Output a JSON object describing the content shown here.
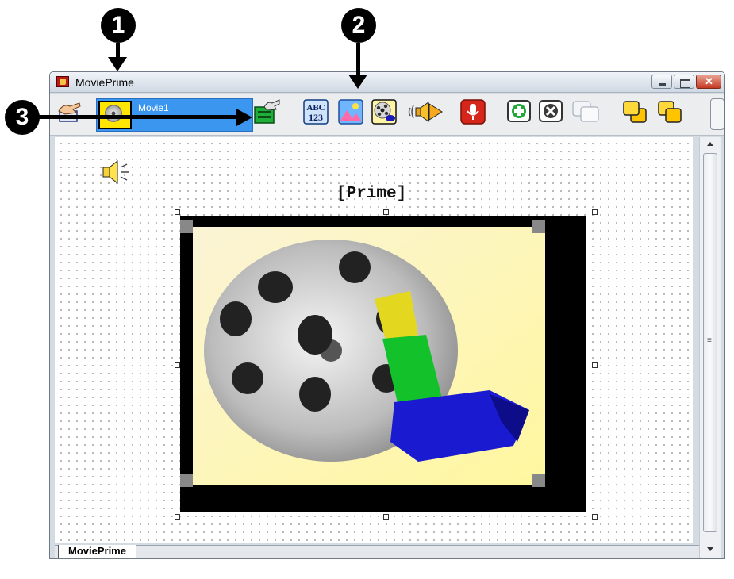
{
  "callouts": [
    "1",
    "2",
    "3"
  ],
  "window": {
    "title": "MoviePrime"
  },
  "toolbar": {
    "movie_name": "Movie1",
    "buttons": [
      {
        "name": "pointer-hand-icon"
      },
      {
        "name": "movie-reel-thumb-icon"
      },
      {
        "name": "green-card-hand-icon"
      },
      {
        "name": "text-abc-123-icon",
        "label_top": "ABC",
        "label_bottom": "123"
      },
      {
        "name": "picture-icon"
      },
      {
        "name": "movie-reel-icon"
      },
      {
        "name": "speaker-play-icon"
      },
      {
        "name": "record-microphone-icon"
      },
      {
        "name": "add-icon"
      },
      {
        "name": "delete-icon"
      },
      {
        "name": "duplicate-pages-icon"
      },
      {
        "name": "bring-forward-icon"
      },
      {
        "name": "send-backward-icon"
      }
    ]
  },
  "canvas": {
    "title_text": "[Prime]",
    "speaker_icon": "speaker-icon",
    "media_icon": "film-reel-image"
  },
  "tabs": [
    {
      "label": "MoviePrime",
      "active": true
    }
  ],
  "colors": {
    "selection_blue": "#3a96ee",
    "film_background": "#fdf6a8",
    "canvas_bg": "#ffffff"
  }
}
